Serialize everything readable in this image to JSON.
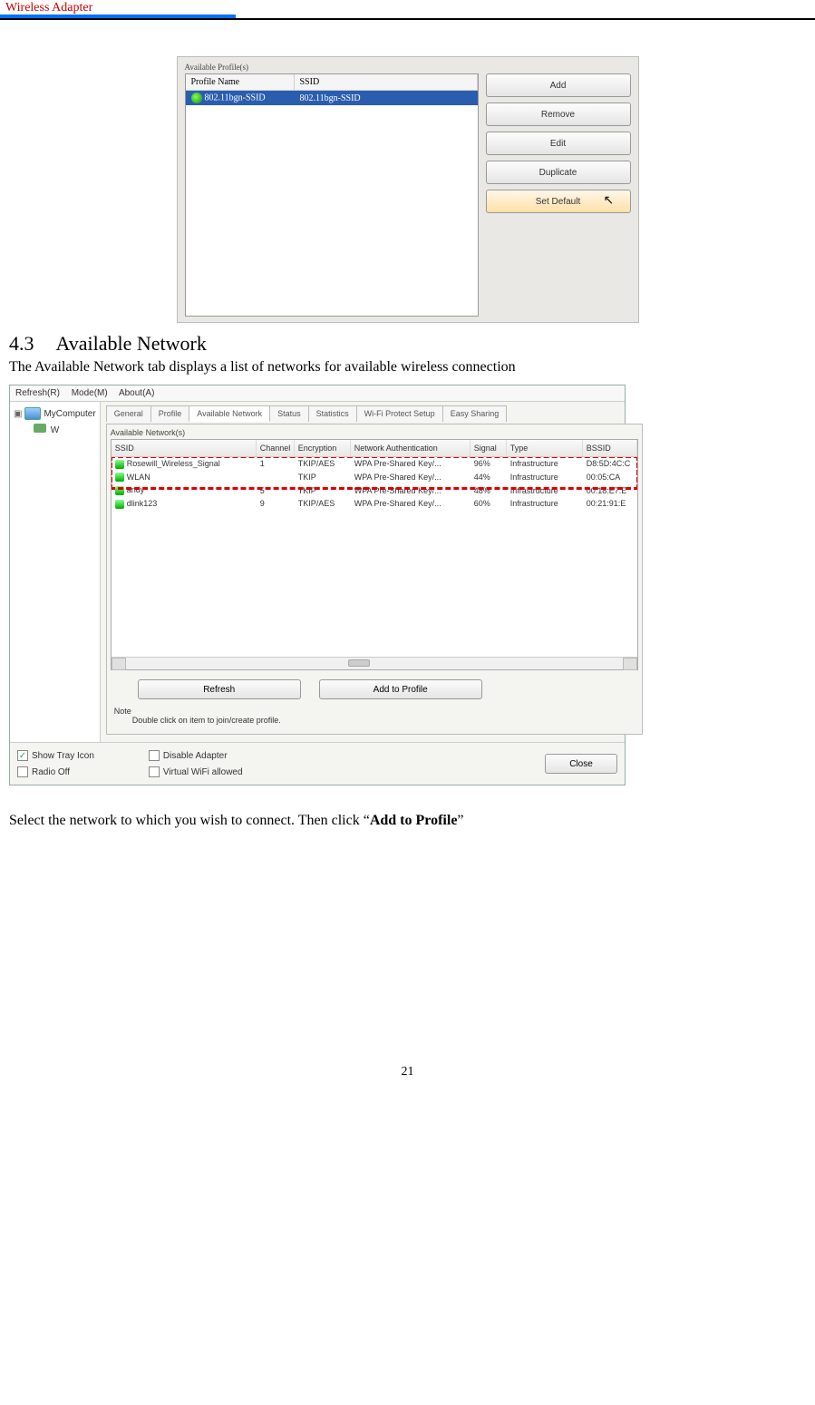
{
  "header": {
    "title": "Wireless  Adapter"
  },
  "profiles": {
    "group_label": "Available Profile(s)",
    "columns": {
      "name": "Profile Name",
      "ssid": "SSID"
    },
    "row": {
      "name": "802.11bgn-SSID",
      "ssid": "802.11bgn-SSID"
    },
    "buttons": {
      "add": "Add",
      "remove": "Remove",
      "edit": "Edit",
      "duplicate": "Duplicate",
      "set_default": "Set Default"
    }
  },
  "section": {
    "number": "4.3",
    "title": "Available Network",
    "intro": "The Available Network tab displays a list of networks for available wireless connection",
    "outro_pre": "Select the network to which you wish to connect. Then click  “",
    "outro_bold": "Add to Profile",
    "outro_post": "”"
  },
  "utility": {
    "menu": {
      "refresh": "Refresh(R)",
      "mode": "Mode(M)",
      "about": "About(A)"
    },
    "tree": {
      "root": "MyComputer",
      "child": "W"
    },
    "tabs": {
      "general": "General",
      "profile": "Profile",
      "available": "Available Network",
      "status": "Status",
      "statistics": "Statistics",
      "wps": "Wi-Fi Protect Setup",
      "easy": "Easy Sharing"
    },
    "networks": {
      "label": "Available Network(s)",
      "headers": {
        "ssid": "SSID",
        "channel": "Channel",
        "encryption": "Encryption",
        "auth": "Network Authentication",
        "signal": "Signal",
        "type": "Type",
        "bssid": "BSSID"
      },
      "rows": [
        {
          "ssid": "Rosewill_Wireless_Signal",
          "channel": "1",
          "encryption": "TKIP/AES",
          "auth": "WPA Pre-Shared Key/...",
          "signal": "96%",
          "type": "Infrastructure",
          "bssid": "D8:5D:4C:C"
        },
        {
          "ssid": "WLAN",
          "channel": "",
          "encryption": "TKIP",
          "auth": "WPA Pre-Shared Key/...",
          "signal": "44%",
          "type": "Infrastructure",
          "bssid": "00:05:CA"
        },
        {
          "ssid": "andy",
          "channel": "5",
          "encryption": "TKIP",
          "auth": "WPA Pre-Shared Key/...",
          "signal": "48%",
          "type": "Infrastructure",
          "bssid": "00:18:E7:E"
        },
        {
          "ssid": "dlink123",
          "channel": "9",
          "encryption": "TKIP/AES",
          "auth": "WPA Pre-Shared Key/...",
          "signal": "60%",
          "type": "Infrastructure",
          "bssid": "00:21:91:E"
        }
      ],
      "refresh_btn": "Refresh",
      "add_btn": "Add to Profile",
      "note_title": "Note",
      "note_text": "Double click on item to join/create profile."
    },
    "bottom": {
      "show_tray": "Show Tray Icon",
      "radio_off": "Radio Off",
      "disable_adapter": "Disable Adapter",
      "virtual_wifi": "Virtual WiFi allowed",
      "close": "Close"
    }
  },
  "page_number": "21"
}
